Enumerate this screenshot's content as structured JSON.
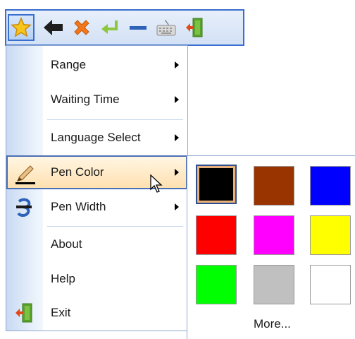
{
  "toolbar": {
    "buttons": [
      {
        "icon": "star-icon",
        "name": "favorites-button",
        "active": true
      },
      {
        "icon": "back-arrow-icon",
        "name": "back-button"
      },
      {
        "icon": "close-x-icon",
        "name": "close-button"
      },
      {
        "icon": "enter-return-icon",
        "name": "enter-button"
      },
      {
        "icon": "minimize-dash-icon",
        "name": "minimize-button"
      },
      {
        "icon": "keyboard-icon",
        "name": "keyboard-button"
      },
      {
        "icon": "exit-door-icon",
        "name": "exit-toolbar-button"
      }
    ]
  },
  "menu": {
    "items": [
      {
        "label": "Range",
        "has_submenu": true
      },
      {
        "label": "Waiting Time",
        "has_submenu": true
      },
      {
        "label": "Language Select",
        "has_submenu": true
      },
      {
        "label": "Pen Color",
        "has_submenu": true,
        "highlighted": true,
        "icon": "pen-icon"
      },
      {
        "label": "Pen Width",
        "has_submenu": true,
        "icon": "pen-width-icon"
      },
      {
        "label": "About",
        "has_submenu": false
      },
      {
        "label": "Help",
        "has_submenu": false
      },
      {
        "label": "Exit",
        "has_submenu": false,
        "icon": "exit-door-icon"
      }
    ]
  },
  "pen_color_submenu": {
    "colors": [
      {
        "name": "black",
        "hex": "#000000",
        "selected": true
      },
      {
        "name": "brown",
        "hex": "#993300"
      },
      {
        "name": "blue",
        "hex": "#0000ff"
      },
      {
        "name": "red",
        "hex": "#ff0000"
      },
      {
        "name": "magenta",
        "hex": "#ff00ff"
      },
      {
        "name": "yellow",
        "hex": "#ffff00"
      },
      {
        "name": "green",
        "hex": "#00ff00"
      },
      {
        "name": "gray",
        "hex": "#c0c0c0"
      },
      {
        "name": "white",
        "hex": "#ffffff"
      }
    ],
    "more_label": "More..."
  },
  "theme": {
    "accent": "#3a6fcf",
    "highlight_top": "#fff6e3",
    "highlight_bottom": "#ffe0b0"
  }
}
